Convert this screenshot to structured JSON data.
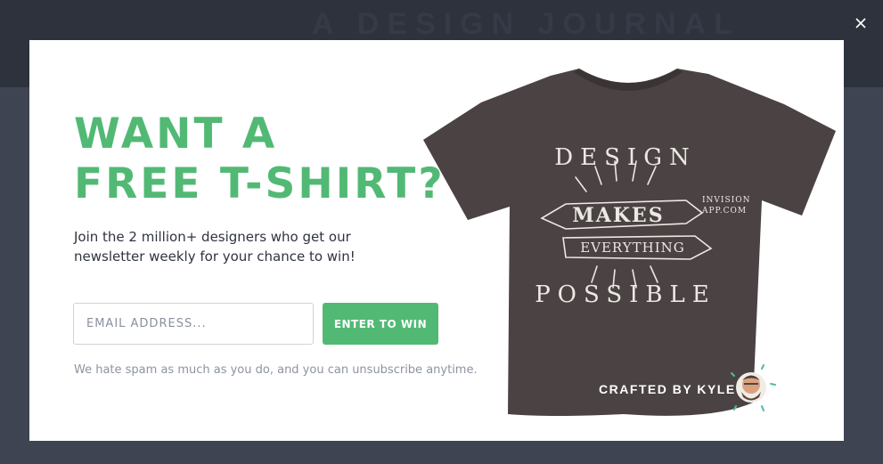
{
  "background": {
    "header_text": "A DESIGN JOURNAL"
  },
  "modal": {
    "headline_line1": "WANT A",
    "headline_line2": "FREE T-SHIRT?",
    "subtext": "Join the 2 million+ designers who get our newsletter weekly for your chance to win!",
    "email_placeholder": "EMAIL ADDRESS...",
    "email_value": "",
    "cta_label": "ENTER TO WIN",
    "disclaimer": "We hate spam as much as you do, and you can unsubscribe anytime.",
    "shirt_print": {
      "word1": "DESIGN",
      "word2": "MAKES",
      "word3": "EVERYTHING",
      "word4": "POSSIBLE",
      "url_line1": "INVISION",
      "url_line2": "APP.COM"
    },
    "credit_prefix": "CRAFTED BY",
    "credit_name": "KYLE STEED"
  },
  "colors": {
    "accent": "#52b975",
    "shirt": "#4a4243",
    "text": "#2f3440",
    "muted": "#8d93a1"
  },
  "icons": {
    "close": "close-icon",
    "avatar": "avatar"
  }
}
